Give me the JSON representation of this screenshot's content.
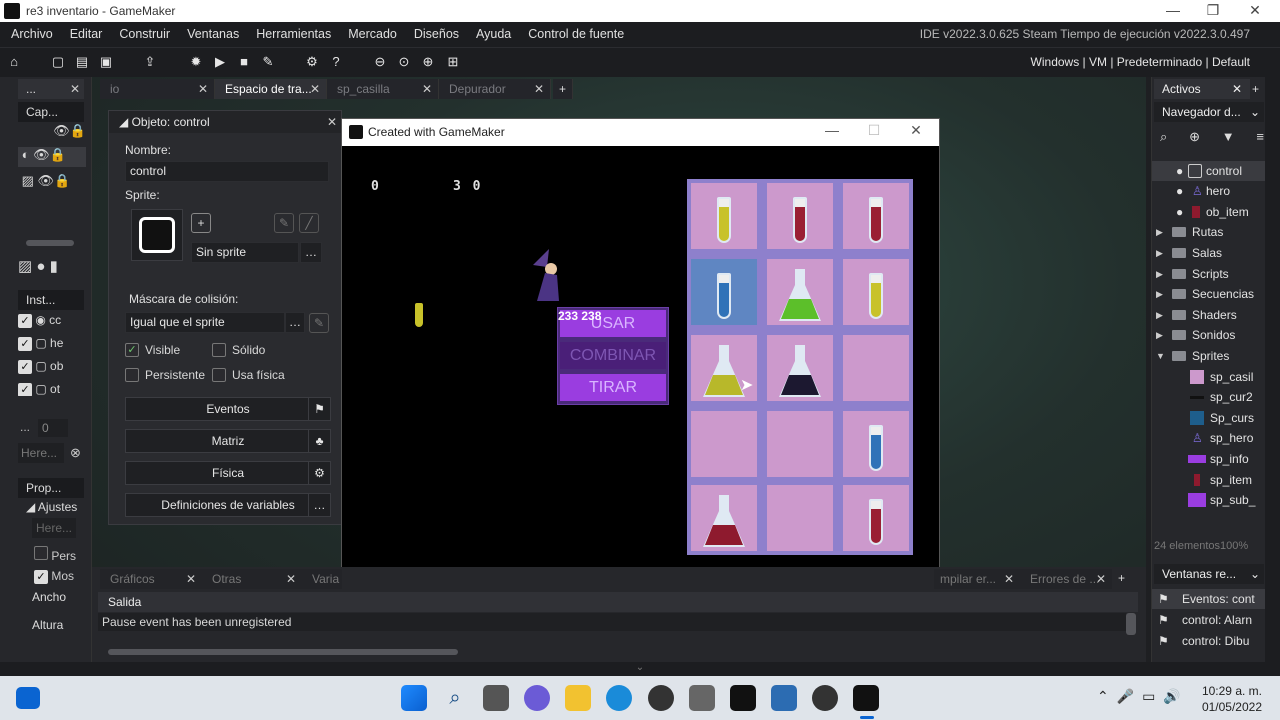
{
  "window": {
    "title": "re3 inventario - GameMaker"
  },
  "menu": [
    "Archivo",
    "Editar",
    "Construir",
    "Ventanas",
    "Herramientas",
    "Mercado",
    "Diseños",
    "Ayuda",
    "Control de fuente"
  ],
  "ide_version": "IDE v2022.3.0.625 Steam  Tiempo de ejecución v2022.3.0.497",
  "target": "Windows | VM | Predeterminado | Default",
  "left": {
    "tab1": "...",
    "layer_label": "Cap...",
    "instances_label": "Inst...",
    "instances": [
      "cc",
      "he",
      "ob",
      "ot"
    ],
    "count_field": "0",
    "ellipsis": "...",
    "search_placeholder": "Here...",
    "props_label": "Prop...",
    "ajustes": "Ajustes",
    "ajustes_search": "Here...",
    "pers": "Pers",
    "mos": "Mos",
    "ancho": "Ancho",
    "altura": "Altura"
  },
  "tabs": [
    {
      "label": "io",
      "active": false
    },
    {
      "label": "Espacio de tra...",
      "active": true
    },
    {
      "label": "sp_casilla",
      "active": false
    },
    {
      "label": "Depurador",
      "active": false
    }
  ],
  "object": {
    "header": "Objeto: control",
    "name_label": "Nombre:",
    "name_value": "control",
    "sprite_label": "Sprite:",
    "sprite_value": "Sin sprite",
    "mask_label": "Máscara de colisión:",
    "mask_value": "Igual que el sprite",
    "visible": "Visible",
    "solid": "Sólido",
    "persistent": "Persistente",
    "physics": "Usa física",
    "btn_events": "Eventos",
    "btn_matrix": "Matriz",
    "btn_physics": "Física",
    "btn_vars": "Definiciones de variables"
  },
  "game": {
    "title": "Created with GameMaker",
    "score_left": "0",
    "score_right": "3 0",
    "menu_nums": "233    238",
    "btn_use": "USAR",
    "btn_combine": "COMBINAR",
    "btn_throw": "TIRAR",
    "colors": {
      "grid_bg": "#8e80cc",
      "cell": "#cc99cc",
      "cell_selected": "#5f86c2"
    }
  },
  "right": {
    "tab": "Activos",
    "nav": "Navegador d...",
    "objects": [
      "control",
      "hero",
      "ob_item"
    ],
    "folders": [
      "Rutas",
      "Salas",
      "Scripts",
      "Secuencias",
      "Shaders",
      "Sonidos",
      "Sprites"
    ],
    "sprites": [
      "sp_casil",
      "sp_cur2",
      "Sp_curs",
      "sp_hero",
      "sp_info",
      "sp_item",
      "sp_sub_"
    ],
    "footer": "24 elementos100%",
    "win_label": "Ventanas re...",
    "events": [
      "Eventos: cont",
      "control: Alarn",
      "control: Dibu"
    ]
  },
  "output": {
    "tabs": [
      "Gráficos",
      "Otras",
      "Varia"
    ],
    "tabs_right": [
      "mpilar er...",
      "Errores de ..."
    ],
    "title": "Salida",
    "line": "Pause event has been unregistered"
  },
  "clock": {
    "time": "10:29 a. m.",
    "date": "01/05/2022"
  }
}
